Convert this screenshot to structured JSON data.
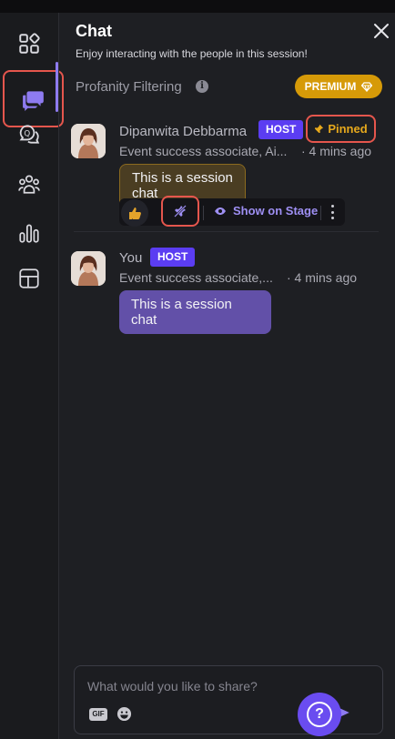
{
  "rail": {
    "items": [
      {
        "icon": "apps-grid-icon"
      },
      {
        "icon": "chat-icon",
        "active": true
      },
      {
        "icon": "qna-icon"
      },
      {
        "icon": "people-icon"
      },
      {
        "icon": "polls-icon"
      },
      {
        "icon": "layout-icon"
      }
    ]
  },
  "header": {
    "title": "Chat",
    "subtitle": "Enjoy interacting with the people in this session!",
    "close_icon": "close-icon"
  },
  "profanity": {
    "label": "Profanity Filtering",
    "premium_label": "PREMIUM"
  },
  "messages": [
    {
      "name": "Dipanwita Debbarma",
      "badge": "HOST",
      "pinned_label": "Pinned",
      "subtitle": "Event success associate, Ai...",
      "time": "· 4 mins ago",
      "text": "This is a session chat",
      "actions": {
        "show_on_stage": "Show on Stage"
      }
    },
    {
      "name": "You",
      "badge": "HOST",
      "subtitle": "Event success associate,...",
      "time": "· 4 mins ago",
      "text": "This is a session chat"
    }
  ],
  "composer": {
    "placeholder": "What would you like to share?",
    "gif_label": "GIF"
  },
  "help_label": "?",
  "colors": {
    "accent": "#6a4cf0",
    "host_badge": "#5b3df2",
    "premium": "#d69a08",
    "pinned": "#e7a91c",
    "highlight_outline": "#e5564d"
  }
}
